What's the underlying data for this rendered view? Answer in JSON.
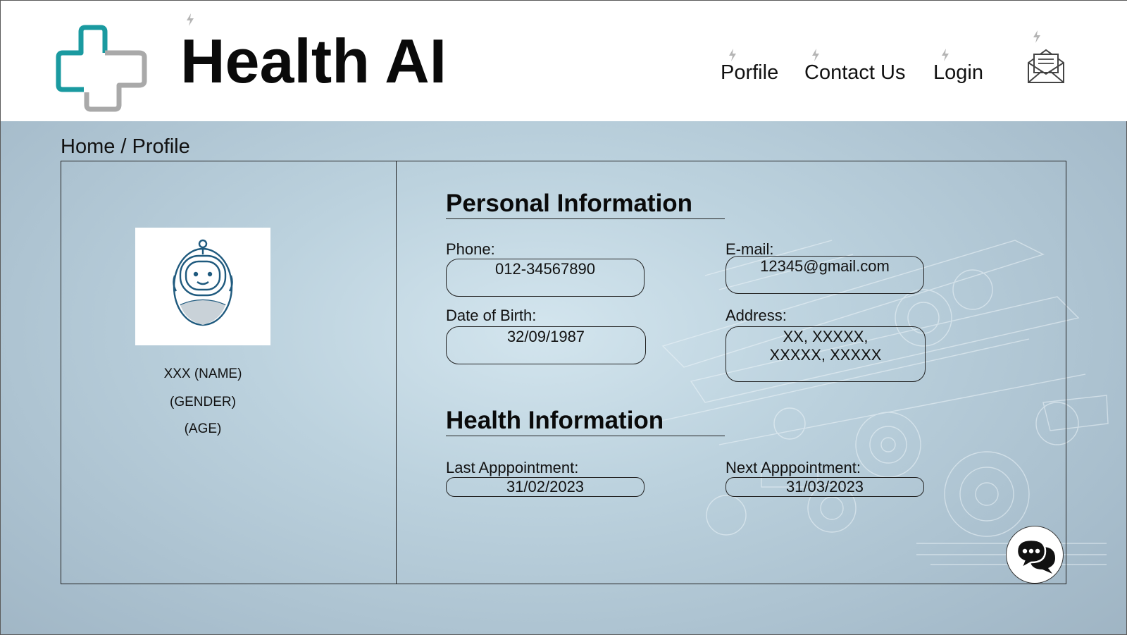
{
  "header": {
    "app_title": "Health AI",
    "nav": [
      {
        "label": "Porfile"
      },
      {
        "label": "Contact Us"
      },
      {
        "label": "Login"
      }
    ],
    "mail_icon": "mail-envelope-icon",
    "logo_icon": "medical-cross-logo-icon"
  },
  "breadcrumb": "Home / Profile",
  "profile": {
    "avatar_icon": "robot-avatar-icon",
    "name": "XXX (NAME)",
    "gender": "(GENDER)",
    "age": "(AGE)"
  },
  "personal_info": {
    "title": "Personal Information",
    "phone_label": "Phone:",
    "phone_value": "012-34567890",
    "email_label": "E-mail:",
    "email_value": "12345@gmail.com",
    "dob_label": "Date of Birth:",
    "dob_value": "32/09/1987",
    "address_label": "Address:",
    "address_line1": "XX, XXXXX,",
    "address_line2": "XXXXX, XXXXX"
  },
  "health_info": {
    "title": "Health Information",
    "last_label": "Last Apppointment:",
    "last_value": "31/02/2023",
    "next_label": "Next Apppointment:",
    "next_value": "31/03/2023"
  },
  "chat_icon": "chat-bubbles-icon",
  "colors": {
    "accent_teal": "#1a9aa0",
    "logo_gray": "#a9a9a9",
    "avatar_blue": "#1f5a7e",
    "background": "#a6bccb"
  }
}
